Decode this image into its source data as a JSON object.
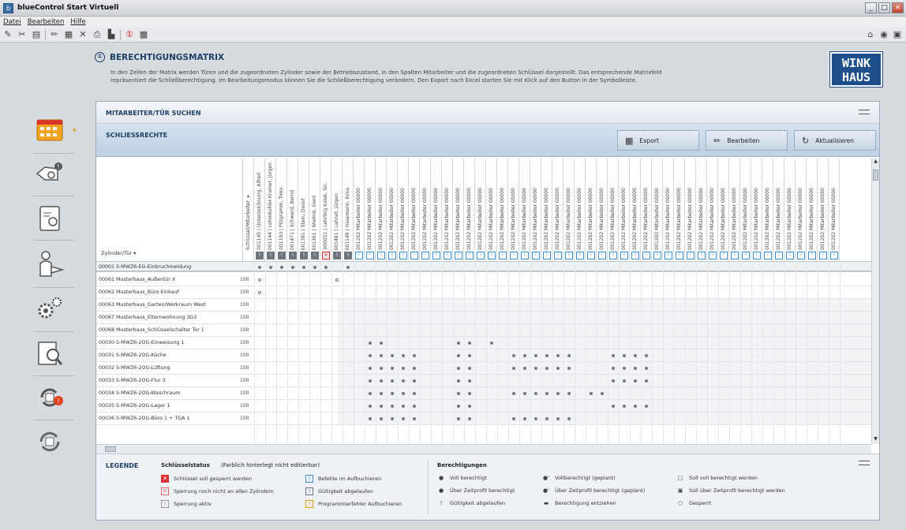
{
  "window": {
    "title": "blueControl Start Virtuell",
    "minimize": "_",
    "maximize": "□",
    "close": "×"
  },
  "menu": [
    "Datei",
    "Bearbeiten",
    "Hilfe"
  ],
  "header": {
    "number": "①",
    "title": "BERECHTIGUNGSMATRIX",
    "desc_line1": "In den Zeilen der Matrix werden Türen und die zugeordneten Zylinder sowie der Betriebszustand, in den Spalten Mitarbeiter und die zugeordneten Schlüssel dargestellt. Das entsprechende Matrixfeld",
    "desc_line2": "repräsentiert die Schließberechtigung. Im Bearbeitungsmodus können Sie die Schließberechtigung verändern. Den Export nach Excel starten Sie mit Klick auf den Button in der Symbolleiste."
  },
  "logo": {
    "line1": "WINK",
    "line2": "HAUS"
  },
  "search_section": {
    "label": "MITARBEITER/TÜR SUCHEN"
  },
  "rights_section": {
    "label": "SCHLIESSRECHTE",
    "buttons": {
      "export": "Export",
      "edit": "Bearbeiten",
      "refresh": "Aktualisieren"
    }
  },
  "matrix": {
    "corner_label": "Zylinder/Tür ▾",
    "status_col_label": "Schlüssel/Mitarbeiter ▾",
    "employee_columns": [
      {
        "label": "001145 | Unterzeichnung, Alfred",
        "status": "d"
      },
      {
        "label": "001144 | Lehmkuhler-Kramer, Jürgen",
        "status": "d"
      },
      {
        "label": "001193 | Pilzgramm, Timo",
        "status": "d"
      },
      {
        "label": "001471 | Schwerd, Bernd",
        "status": "d"
      },
      {
        "label": "001381 | Stein, David",
        "status": "d"
      },
      {
        "label": "001361 | Wiehnk, Gerd",
        "status": "d"
      },
      {
        "label": "000051 | Lehrling Kalek, Sic.",
        "status": "r"
      },
      {
        "label": "001481 | Lahnet, Jürgen",
        "status": "d"
      },
      {
        "label": "001149 | Hasemann, Ilona",
        "status": "d"
      }
    ],
    "key_column_prefix": "001202 Mitarbeiter 00000",
    "key_column_count": 44,
    "global_row": "00001 S-MWZ6-EG-Einbruchmeldung",
    "rows": [
      {
        "label": "00061 Musterhaus_Außentür X",
        "count": "100"
      },
      {
        "label": "00062 Musterhaus_Büro Einkauf",
        "count": "100"
      },
      {
        "label": "00063 Musterhaus_Garten/Werkraum West",
        "count": "100"
      },
      {
        "label": "00067 Musterhaus_Elternwohnung 3G3",
        "count": "100"
      },
      {
        "label": "00068 Musterhaus_Schlüsselschalter Tor 1",
        "count": "100"
      },
      {
        "label": "00030 S-MWZ6-2OG-Einweisung 1",
        "count": "100"
      },
      {
        "label": "00031 S-MWZ6-2OG-Küche",
        "count": "100"
      },
      {
        "label": "00032 S-MWZ6-2OG-Lüftung",
        "count": "100"
      },
      {
        "label": "00033 S-MWZ6-2OG-Flur 3",
        "count": "100"
      },
      {
        "label": "00034 S-MWZ6-2OG-Waschraum",
        "count": "100"
      },
      {
        "label": "00035 S-MWZ6-2OG-Lager 1",
        "count": "100"
      },
      {
        "label": "00036 S-MWZ6-2OG-Büro 1 + TGA 1",
        "count": "100"
      }
    ]
  },
  "legend": {
    "title": "LEGENDE",
    "status_title": "Schlüsselstatus",
    "status_note": "(Farblich hinterlegt nicht editierbar)",
    "status_items": [
      {
        "label": "Schlüssel soll gesperrt werden",
        "color": "#d33"
      },
      {
        "label": "Sperrung noch nicht an allen Zylindern",
        "color": "#e66"
      },
      {
        "label": "Sperrung aktiv",
        "color": "#999"
      },
      {
        "label": "Befehle im Aufbuchieren",
        "color": "#3b8dd0"
      },
      {
        "label": "Gültigkeit abgelaufen",
        "color": "#6c747d"
      },
      {
        "label": "Programmierfehler Aufbuchieren",
        "color": "#e39d1e"
      }
    ],
    "rights_title": "Berechtigungen",
    "rights_items": [
      {
        "symbol": "●",
        "label": "Voll berechtigt"
      },
      {
        "symbol": "●",
        "label": "Über Zeitprofil berechtigt"
      },
      {
        "symbol": "!",
        "label": "Gültigkeit abgelaufen"
      },
      {
        "symbol": "●'",
        "label": "Vollberechtigt (geplant)"
      },
      {
        "symbol": "●'",
        "label": "Über Zeitprofil berechtigt (geplant)"
      },
      {
        "symbol": "▬",
        "label": "Berechtigung entziehen"
      },
      {
        "symbol": "□",
        "label": "Soll voll berechtigt werden"
      },
      {
        "symbol": "▣",
        "label": "Soll über Zeitprofil berechtigt werden"
      },
      {
        "symbol": "○",
        "label": "Gesperrt"
      }
    ]
  }
}
